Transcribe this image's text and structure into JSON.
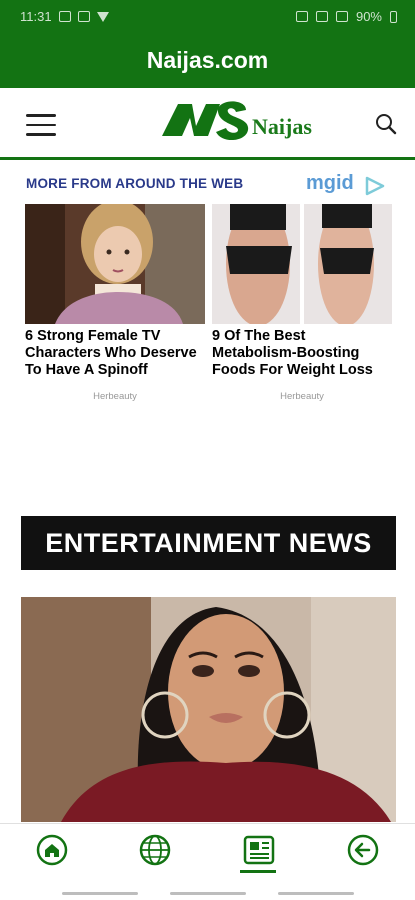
{
  "status_bar": {
    "time": "11:31",
    "battery": "90%"
  },
  "app": {
    "title": "Naijas.com",
    "logo_text": "Naijas"
  },
  "header": {
    "menu_icon": "hamburger-icon",
    "search_icon": "search-icon"
  },
  "widget": {
    "heading": "MORE FROM AROUND THE WEB",
    "brand": "mgid",
    "cards": [
      {
        "headline": "6 Strong Female TV Characters Who Deserve To Have A Spinoff",
        "source": "Herbeauty"
      },
      {
        "headline": "9 Of The Best Metabolism-Boosting Foods For Weight Loss",
        "source": "Herbeauty"
      }
    ]
  },
  "section": {
    "title": "ENTERTAINMENT NEWS"
  },
  "bottom_nav": {
    "items": [
      {
        "icon": "home-icon"
      },
      {
        "icon": "globe-icon"
      },
      {
        "icon": "news-icon",
        "active": true
      },
      {
        "icon": "back-icon"
      }
    ]
  },
  "colors": {
    "brand_green": "#137313",
    "heading_blue": "#2a3a8a",
    "mgid_blue": "#5b9bd5"
  }
}
